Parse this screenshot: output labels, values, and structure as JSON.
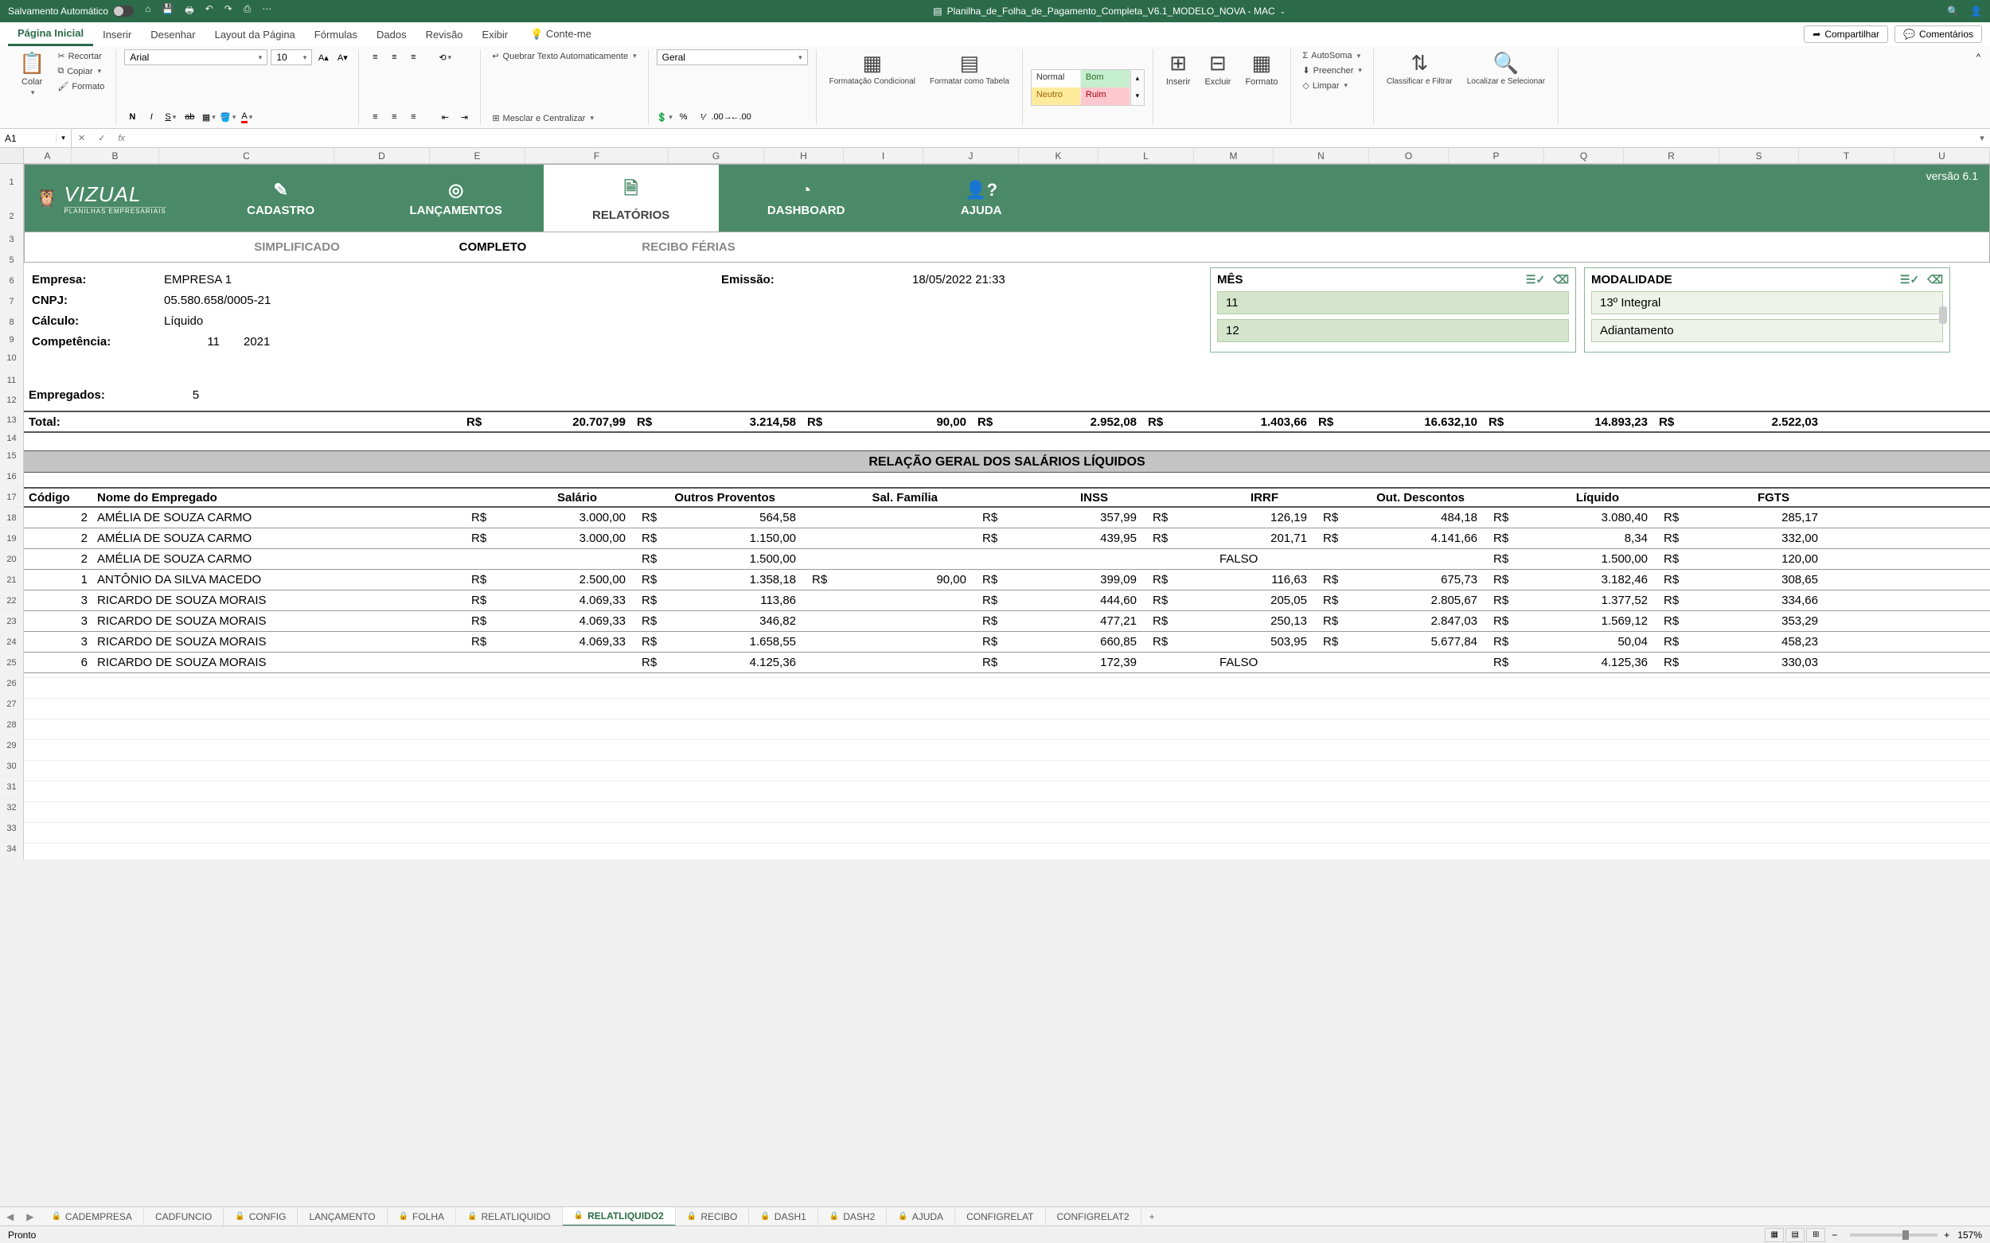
{
  "titlebar": {
    "autosave": "Salvamento Automático",
    "filename": "Planilha_de_Folha_de_Pagamento_Completa_V6.1_MODELO_NOVA - MAC"
  },
  "ribbonTabs": {
    "home": "Página Inicial",
    "insert": "Inserir",
    "draw": "Desenhar",
    "layout": "Layout da Página",
    "formulas": "Fórmulas",
    "data": "Dados",
    "review": "Revisão",
    "view": "Exibir",
    "tellme": "Conte-me",
    "share": "Compartilhar",
    "comments": "Comentários"
  },
  "ribbon": {
    "paste": "Colar",
    "cut": "Recortar",
    "copy": "Copiar",
    "format": "Formato",
    "font": "Arial",
    "size": "10",
    "wrap": "Quebrar Texto Automaticamente",
    "merge": "Mesclar e Centralizar",
    "numfmt": "Geral",
    "condfmt": "Formatação Condicional",
    "fmttable": "Formatar como Tabela",
    "style_normal": "Normal",
    "style_bom": "Bom",
    "style_neutro": "Neutro",
    "style_ruim": "Ruim",
    "insertc": "Inserir",
    "deletec": "Excluir",
    "formatc": "Formato",
    "autosum": "AutoSoma",
    "fill": "Preencher",
    "clear": "Limpar",
    "sort": "Classificar e Filtrar",
    "find": "Localizar e Selecionar"
  },
  "namebox": "A1",
  "columns": [
    "A",
    "B",
    "C",
    "D",
    "E",
    "F",
    "G",
    "H",
    "I",
    "J",
    "K",
    "L",
    "M",
    "N",
    "O",
    "P",
    "Q",
    "R",
    "S",
    "T",
    "U"
  ],
  "banner": {
    "brand": "VIZUAL",
    "sub": "PLANILHAS EMPRESARIAIS",
    "version": "versão 6.1",
    "nav": {
      "cadastro": "CADASTRO",
      "lanc": "LANÇAMENTOS",
      "relat": "RELATÓRIOS",
      "dash": "DASHBOARD",
      "ajuda": "AJUDA"
    }
  },
  "subnav": {
    "simpl": "SIMPLIFICADO",
    "compl": "COMPLETO",
    "recibo": "RECIBO FÉRIAS"
  },
  "info": {
    "empresa_l": "Empresa:",
    "empresa_v": "EMPRESA 1",
    "cnpj_l": "CNPJ:",
    "cnpj_v": "05.580.658/0005-21",
    "calc_l": "Cálculo:",
    "calc_v": "Líquido",
    "comp_l": "Competência:",
    "comp_m": "11",
    "comp_y": "2021",
    "emiss_l": "Emissão:",
    "emiss_v": "18/05/2022 21:33",
    "emp_l": "Empregados:",
    "emp_v": "5",
    "total_l": "Total:"
  },
  "slicers": {
    "mes": {
      "title": "MÊS",
      "opt1": "11",
      "opt2": "12"
    },
    "mod": {
      "title": "MODALIDADE",
      "opt1": "13º Integral",
      "opt2": "Adiantamento"
    }
  },
  "totals": {
    "cur": "R$",
    "salario": "20.707,99",
    "outprov": "3.214,58",
    "salfam": "90,00",
    "inss": "2.952,08",
    "irrf": "1.403,66",
    "outdesc": "16.632,10",
    "liquido": "14.893,23",
    "fgts": "2.522,03"
  },
  "section": "RELAÇÃO GERAL DOS SALÁRIOS LÍQUIDOS",
  "headers": {
    "cod": "Código",
    "nome": "Nome do Empregado",
    "sal": "Salário",
    "outprov": "Outros Proventos",
    "salfam": "Sal. Família",
    "inss": "INSS",
    "irrf": "IRRF",
    "outdesc": "Out. Descontos",
    "liq": "Líquido",
    "fgts": "FGTS"
  },
  "rows": [
    {
      "cod": "2",
      "nome": "AMÉLIA DE SOUZA CARMO",
      "sal": "3.000,00",
      "outprov": "564,58",
      "salfam": "",
      "inss": "357,99",
      "irrf": "126,19",
      "outdesc": "484,18",
      "liq": "3.080,40",
      "fgts": "285,17"
    },
    {
      "cod": "2",
      "nome": "AMÉLIA DE SOUZA CARMO",
      "sal": "3.000,00",
      "outprov": "1.150,00",
      "salfam": "",
      "inss": "439,95",
      "irrf": "201,71",
      "outdesc": "4.141,66",
      "liq": "8,34",
      "fgts": "332,00"
    },
    {
      "cod": "2",
      "nome": "AMÉLIA DE SOUZA CARMO",
      "sal": "",
      "outprov": "1.500,00",
      "salfam": "",
      "inss": "",
      "irrf": "FALSO",
      "outdesc": "",
      "liq": "1.500,00",
      "fgts": "120,00"
    },
    {
      "cod": "1",
      "nome": "ANTÔNIO DA SILVA MACEDO",
      "sal": "2.500,00",
      "outprov": "1.358,18",
      "salfam": "90,00",
      "inss": "399,09",
      "irrf": "116,63",
      "outdesc": "675,73",
      "liq": "3.182,46",
      "fgts": "308,65"
    },
    {
      "cod": "3",
      "nome": "RICARDO DE SOUZA MORAIS",
      "sal": "4.069,33",
      "outprov": "113,86",
      "salfam": "",
      "inss": "444,60",
      "irrf": "205,05",
      "outdesc": "2.805,67",
      "liq": "1.377,52",
      "fgts": "334,66"
    },
    {
      "cod": "3",
      "nome": "RICARDO DE SOUZA MORAIS",
      "sal": "4.069,33",
      "outprov": "346,82",
      "salfam": "",
      "inss": "477,21",
      "irrf": "250,13",
      "outdesc": "2.847,03",
      "liq": "1.569,12",
      "fgts": "353,29"
    },
    {
      "cod": "3",
      "nome": "RICARDO DE SOUZA MORAIS",
      "sal": "4.069,33",
      "outprov": "1.658,55",
      "salfam": "",
      "inss": "660,85",
      "irrf": "503,95",
      "outdesc": "5.677,84",
      "liq": "50,04",
      "fgts": "458,23"
    },
    {
      "cod": "6",
      "nome": "RICARDO DE SOUZA MORAIS",
      "sal": "",
      "outprov": "4.125,36",
      "salfam": "",
      "inss": "172,39",
      "irrf": "FALSO",
      "outdesc": "",
      "liq": "4.125,36",
      "fgts": "330,03"
    }
  ],
  "cur": "R$",
  "tabs": [
    {
      "name": "CADEMPRESA",
      "lock": true
    },
    {
      "name": "CADFUNCIO",
      "lock": false
    },
    {
      "name": "CONFIG",
      "lock": true
    },
    {
      "name": "LANÇAMENTO",
      "lock": false
    },
    {
      "name": "FOLHA",
      "lock": true
    },
    {
      "name": "RELATLIQUIDO",
      "lock": true
    },
    {
      "name": "RELATLIQUIDO2",
      "lock": true,
      "active": true
    },
    {
      "name": "RECIBO",
      "lock": true
    },
    {
      "name": "DASH1",
      "lock": true
    },
    {
      "name": "DASH2",
      "lock": true
    },
    {
      "name": "AJUDA",
      "lock": true
    },
    {
      "name": "CONFIGRELAT",
      "lock": false
    },
    {
      "name": "CONFIGRELAT2",
      "lock": false
    }
  ],
  "status": {
    "ready": "Pronto",
    "zoom": "157%"
  }
}
